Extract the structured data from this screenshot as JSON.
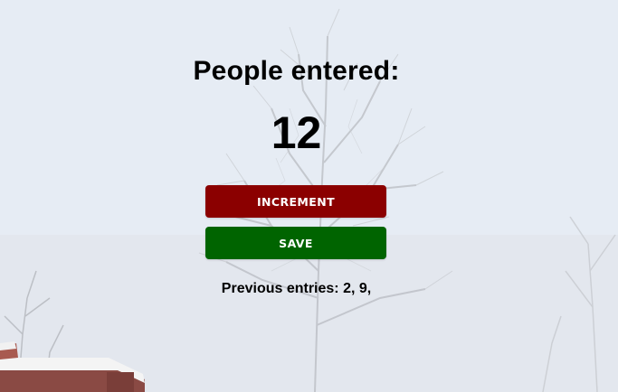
{
  "counter": {
    "heading": "People entered:",
    "count": "12"
  },
  "buttons": {
    "increment_label": "Increment",
    "save_label": "Save"
  },
  "previous_entries": {
    "text": "Previous entries: 2, 9,"
  },
  "colors": {
    "increment_button": "#8b0000",
    "save_button": "#006400"
  }
}
